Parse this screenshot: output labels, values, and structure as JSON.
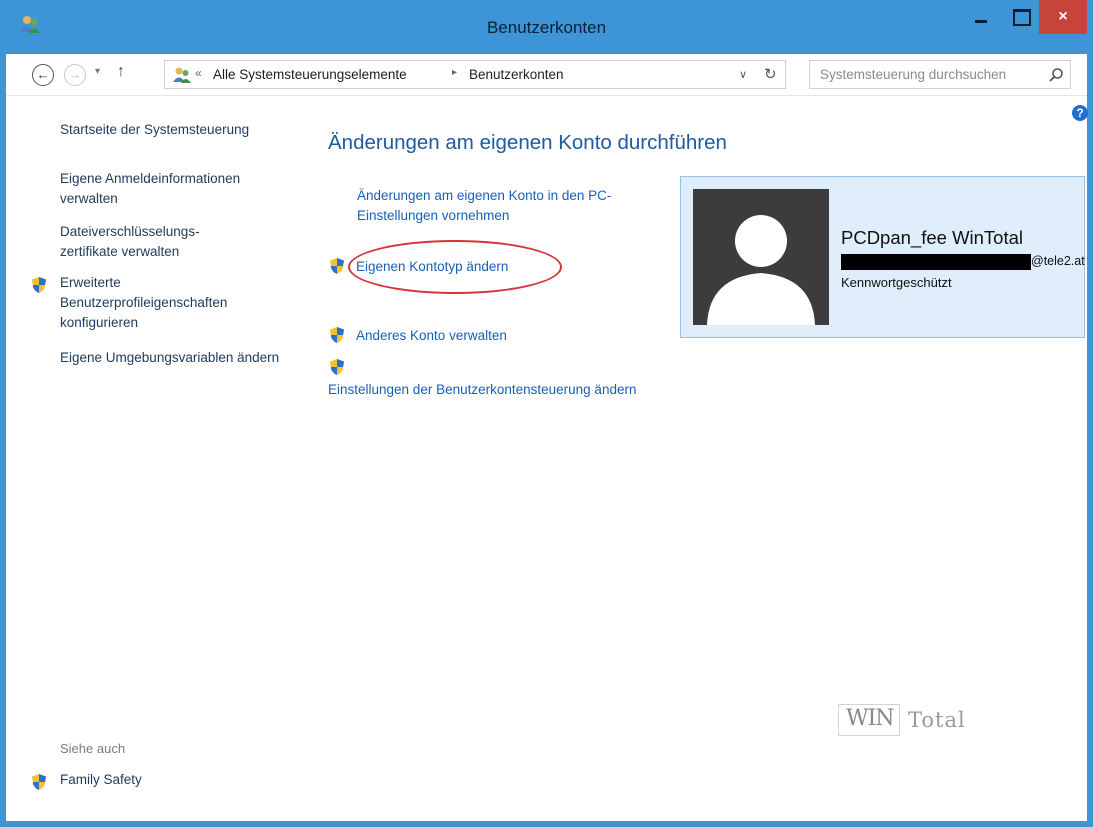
{
  "window": {
    "title": "Benutzerkonten",
    "close_glyph": "×"
  },
  "navigation": {
    "back_glyph": "←",
    "forward_glyph": "→",
    "dropdown_glyph": "▾",
    "up_glyph": "↑",
    "breadcrumb": {
      "overflow_glyph": "«",
      "items": [
        "Alle Systemsteuerungselemente",
        "Benutzerkonten"
      ],
      "separator_glyph": "▸"
    },
    "address_dropdown_glyph": "∨",
    "refresh_glyph": "↻",
    "search_placeholder": "Systemsteuerung durchsuchen"
  },
  "help": {
    "glyph": "?"
  },
  "sidebar": {
    "links": [
      {
        "label": "Startseite der Systemsteuerung",
        "shield": false
      },
      {
        "label": "Eigene Anmeldeinformationen verwalten",
        "shield": false
      },
      {
        "label": "Dateiverschlüsselungs-zertifikate verwalten",
        "shield": false
      },
      {
        "label": "Erweiterte Benutzerprofileigenschaften konfigurieren",
        "shield": true
      },
      {
        "label": "Eigene Umgebungsvariablen ändern",
        "shield": false
      }
    ],
    "see_also_label": "Siehe auch",
    "family_safety_label": "Family Safety"
  },
  "main": {
    "title": "Änderungen am eigenen Konto durchführen",
    "links": [
      {
        "label": "Änderungen am eigenen Konto in den PC-Einstellungen vornehmen",
        "shield": false
      },
      {
        "label": "Eigenen Kontotyp ändern",
        "shield": true,
        "highlighted": true
      },
      {
        "label": "Anderes Konto verwalten",
        "shield": true
      },
      {
        "label": "Einstellungen der Benutzerkontensteuerung ändern",
        "shield": true
      }
    ]
  },
  "account": {
    "name": "PCDpan_fee WinTotal",
    "email_suffix": "@tele2.at",
    "status": "Kennwortgeschützt"
  },
  "watermark": {
    "part1": "WIN",
    "part2": "Total"
  },
  "colors": {
    "titlebar": "#3d95d8",
    "close_button": "#c7443a",
    "link": "#1a5fb4",
    "heading": "#1e5aa0",
    "highlight_ring": "#d7333a",
    "card_background": "#dfeefa"
  }
}
